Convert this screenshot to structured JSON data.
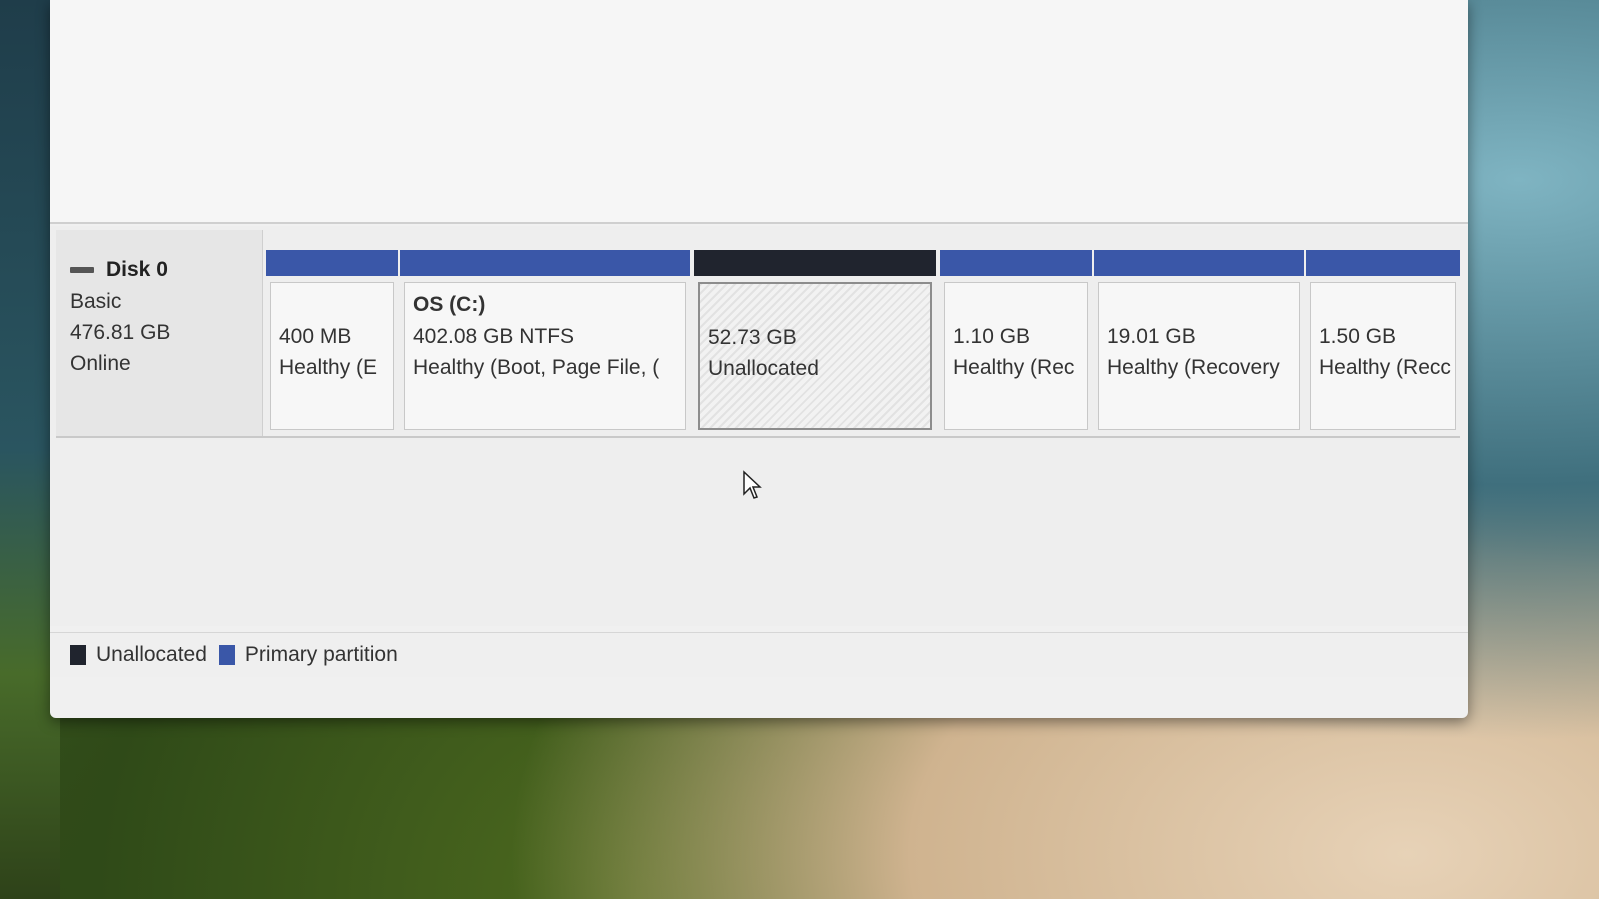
{
  "disk": {
    "name": "Disk 0",
    "type": "Basic",
    "size": "476.81 GB",
    "status": "Online"
  },
  "partitions": [
    {
      "title": "",
      "size": "400 MB",
      "status": "Healthy (E",
      "kind": "primary"
    },
    {
      "title": "OS  (C:)",
      "size": "402.08 GB NTFS",
      "status": "Healthy (Boot, Page File, (",
      "kind": "primary"
    },
    {
      "title": "",
      "size": "52.73 GB",
      "status": "Unallocated",
      "kind": "unallocated"
    },
    {
      "title": "",
      "size": "1.10 GB",
      "status": "Healthy (Rec",
      "kind": "primary"
    },
    {
      "title": "",
      "size": "19.01 GB",
      "status": "Healthy (Recovery",
      "kind": "primary"
    },
    {
      "title": "",
      "size": "1.50 GB",
      "status": "Healthy (Recc",
      "kind": "primary"
    }
  ],
  "legend": {
    "unallocated": "Unallocated",
    "primary": "Primary partition"
  },
  "colors": {
    "primary_bar": "#3a57a8",
    "unallocated_bar": "#20242e"
  }
}
